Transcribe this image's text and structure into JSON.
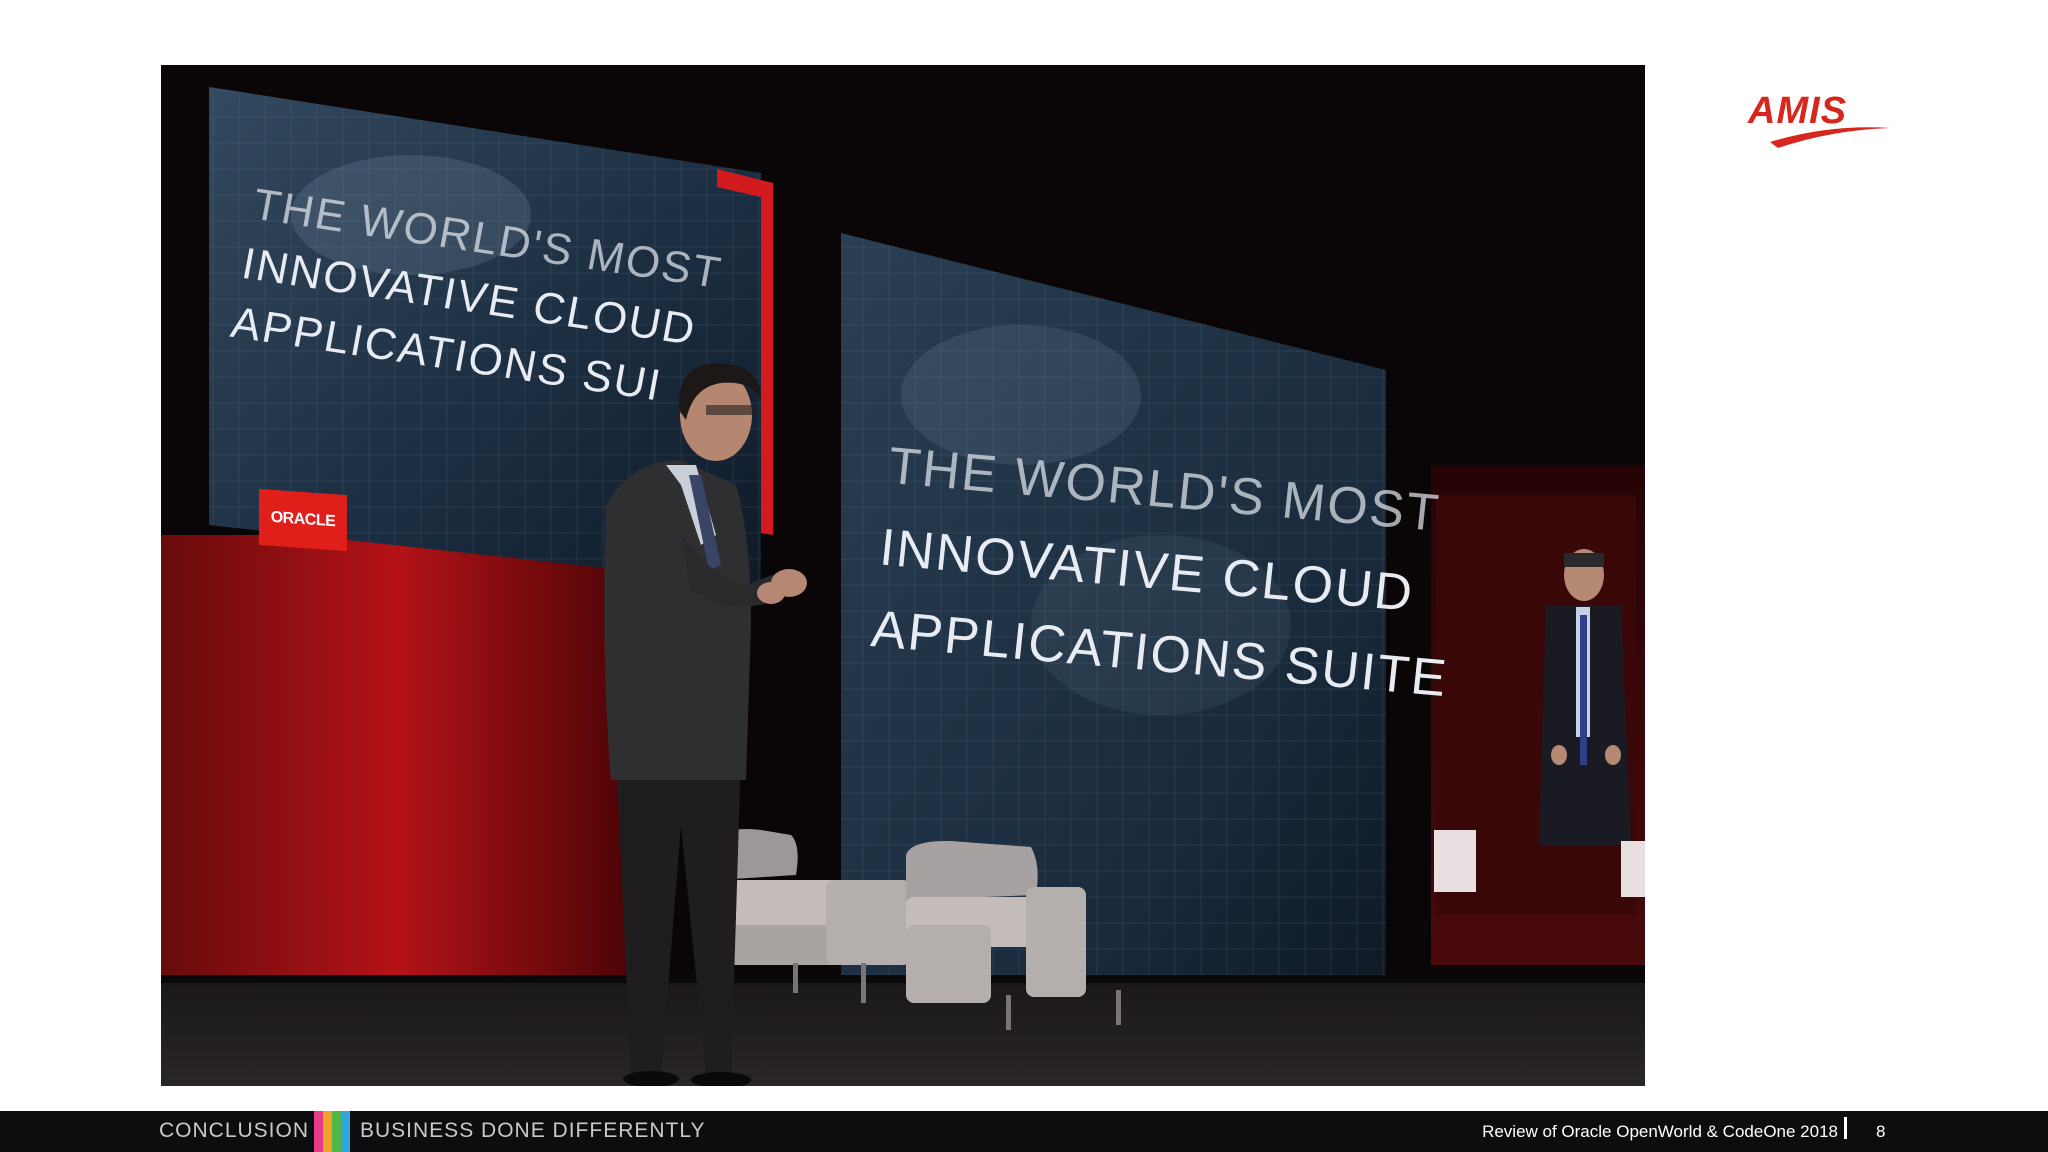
{
  "logo": {
    "text": "AMIS"
  },
  "photo": {
    "left_screen": {
      "line1": "The World's Most",
      "line2": "Innovative Cloud",
      "line3": "Applications Sui",
      "badge": "ORACLE"
    },
    "center_screen": {
      "line1": "The World's Most",
      "line2": "Innovative Cloud",
      "line3": "Applications Suite"
    }
  },
  "footer": {
    "section": "CONCLUSION",
    "tagline": "BUSINESS DONE DIFFERENTLY",
    "title": "Review of Oracle OpenWorld & CodeOne 2018",
    "page": "8",
    "bar_colors": [
      "#e63d8b",
      "#f3a12a",
      "#4fb848",
      "#33a5dc"
    ]
  },
  "colors": {
    "brand_red": "#d7261e",
    "footer_bg": "#0d0d0f"
  }
}
